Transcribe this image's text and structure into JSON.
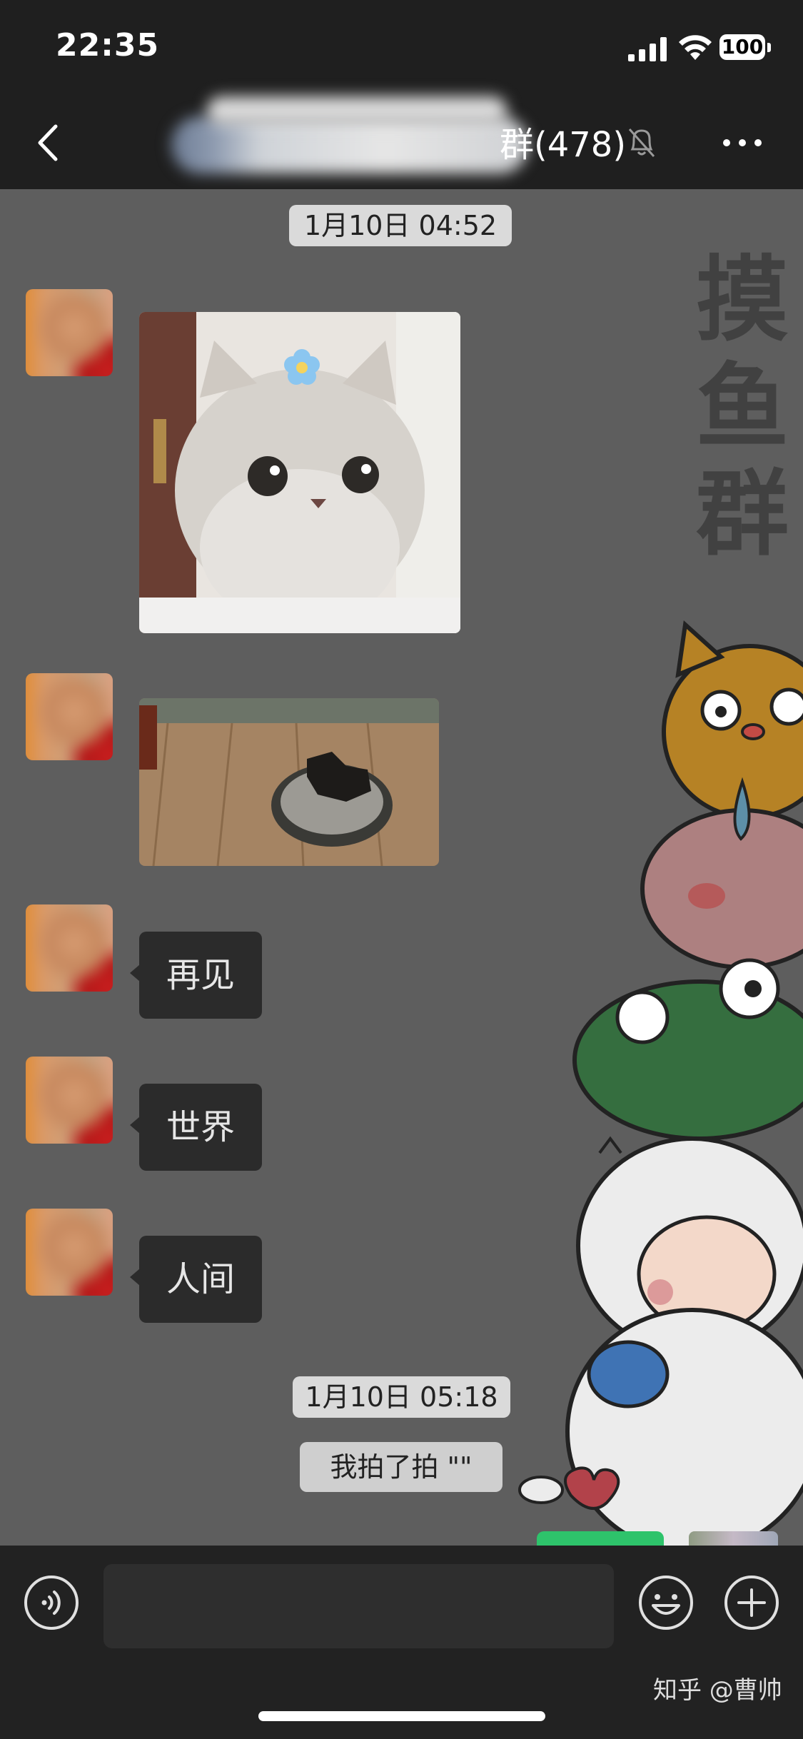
{
  "status_bar": {
    "time": "22:35",
    "battery": "100"
  },
  "nav": {
    "group_count": "群(478)"
  },
  "chat": {
    "timestamp_1": "1月10日 04:52",
    "timestamp_2": "1月10日 05:18",
    "messages": [
      {
        "type": "image",
        "subject": "cat-with-flower"
      },
      {
        "type": "image",
        "subject": "burnt-food-on-plate"
      },
      {
        "type": "text",
        "text": "再见"
      },
      {
        "type": "text",
        "text": "世界"
      },
      {
        "type": "text",
        "text": "人间"
      }
    ],
    "system_message": "我拍了拍 \"\""
  },
  "wallpaper": {
    "title": "摸鱼群"
  },
  "input": {
    "placeholder": ""
  },
  "watermark": "知乎 @曹帅",
  "colors": {
    "bar_background": "#1f1f1f",
    "chat_background": "#5e5e5e",
    "bubble_background": "#2b2b2b",
    "send_green": "#2ec36b"
  }
}
